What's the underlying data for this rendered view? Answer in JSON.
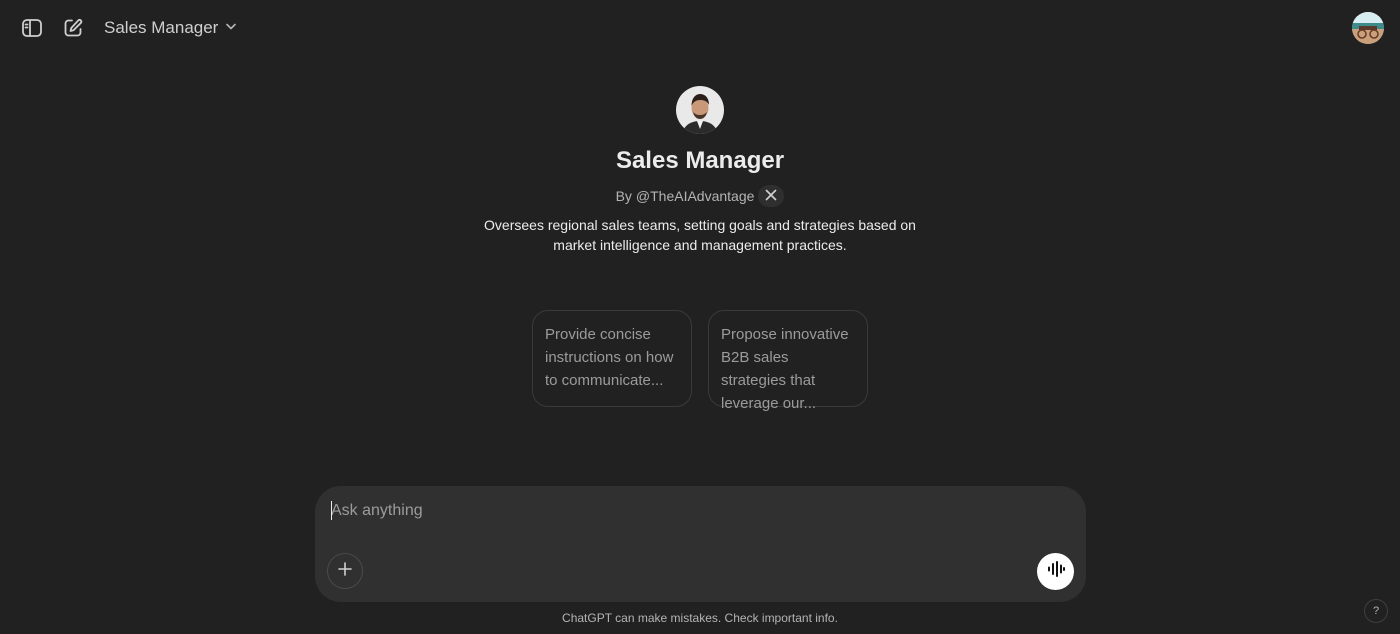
{
  "header": {
    "model_name": "Sales Manager",
    "sidebar_toggle_icon": "sidebar-toggle-icon",
    "new_chat_icon": "compose-icon",
    "dropdown_icon": "chevron-down-icon"
  },
  "gpt": {
    "name": "Sales Manager",
    "byline_prefix": "By",
    "author": "@TheAIAdvantage",
    "author_social_icon": "x-logo-icon",
    "description": "Oversees regional sales teams, setting goals and strategies based on market intelligence and management practices."
  },
  "suggestions": [
    {
      "text": "Provide concise instructions on how to communicate..."
    },
    {
      "text": "Propose innovative B2B sales strategies that leverage our..."
    }
  ],
  "composer": {
    "placeholder": "Ask anything",
    "value": "",
    "attach_icon": "plus-icon",
    "voice_icon": "voice-waveform-icon"
  },
  "footer": {
    "disclaimer": "ChatGPT can make mistakes. Check important info.",
    "help_label": "?"
  },
  "colors": {
    "background": "#212121",
    "composer_bg": "#303030",
    "text_primary": "#ececec",
    "text_secondary": "#b4b4b4",
    "suggestion_text": "#9b9b9b"
  }
}
